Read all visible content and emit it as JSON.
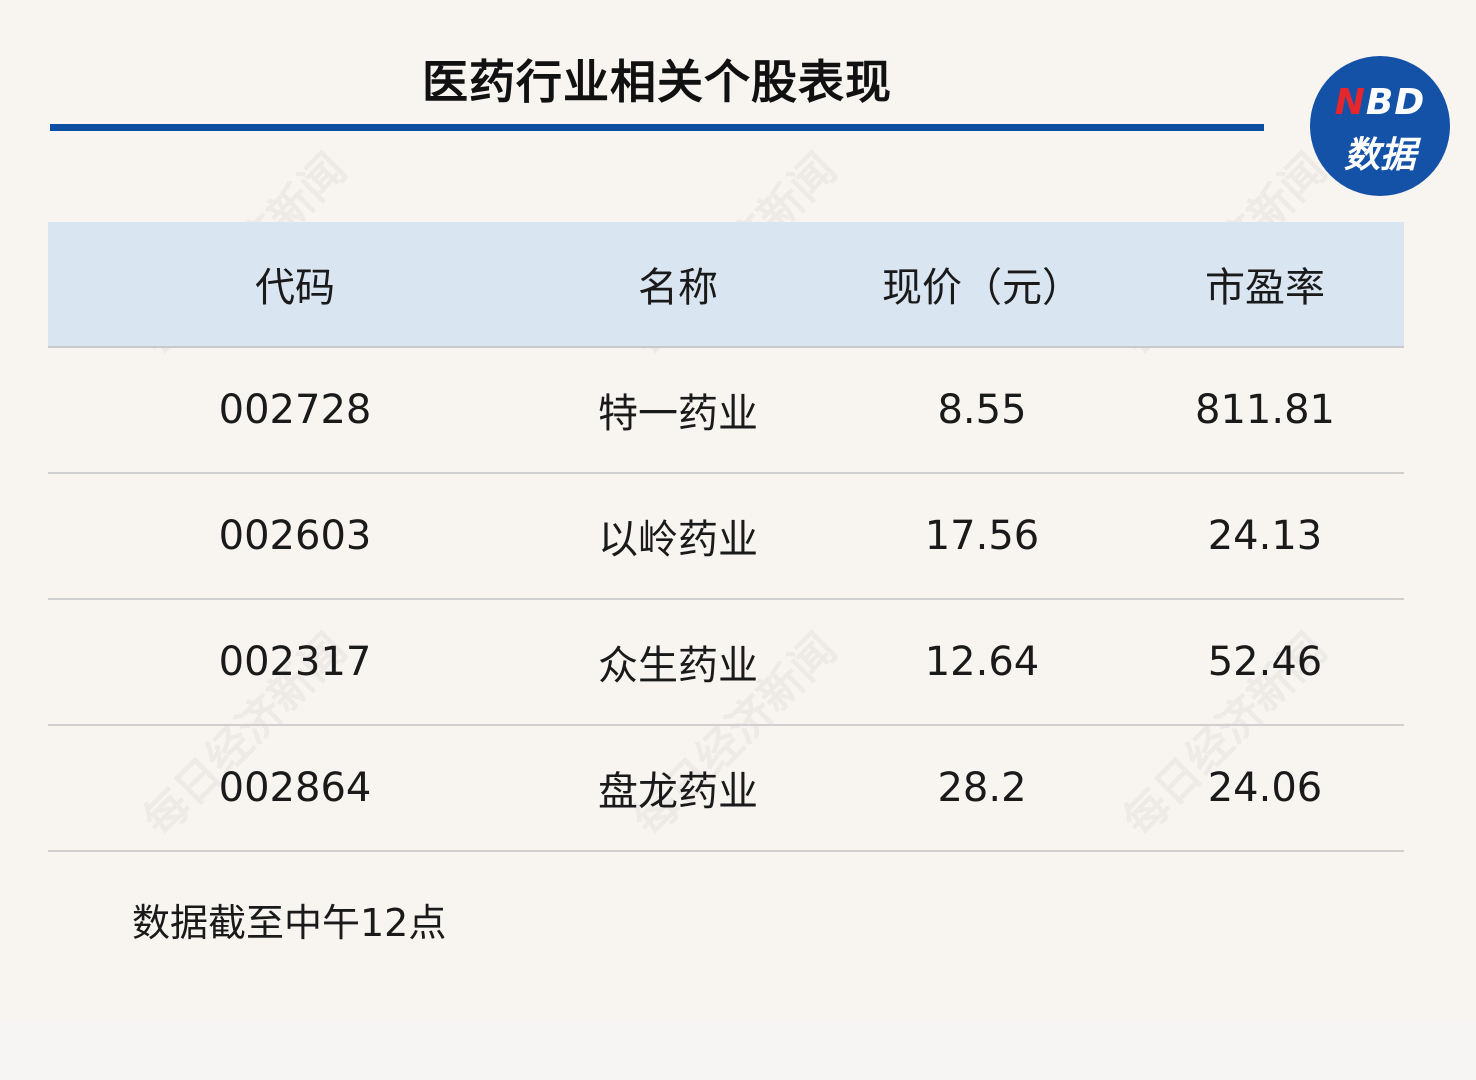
{
  "title": "医药行业相关个股表现",
  "logo": {
    "line1_n": "N",
    "line1_rest": "BD",
    "line2": "数据"
  },
  "watermark": "每日经济新闻",
  "table": {
    "headers": [
      "代码",
      "名称",
      "现价（元）",
      "市盈率"
    ],
    "rows": [
      [
        "002728",
        "特一药业",
        "8.55",
        "811.81"
      ],
      [
        "002603",
        "以岭药业",
        "17.56",
        "24.13"
      ],
      [
        "002317",
        "众生药业",
        "12.64",
        "52.46"
      ],
      [
        "002864",
        "盘龙药业",
        "28.2",
        "24.06"
      ]
    ]
  },
  "footnote": "数据截至中午12点",
  "colors": {
    "accent": "#0b4ea2",
    "header_bg": "#d9e5f0",
    "page_bg": "#f8f5f1",
    "logo_bg": "#1452a8",
    "logo_red": "#e5262c"
  }
}
